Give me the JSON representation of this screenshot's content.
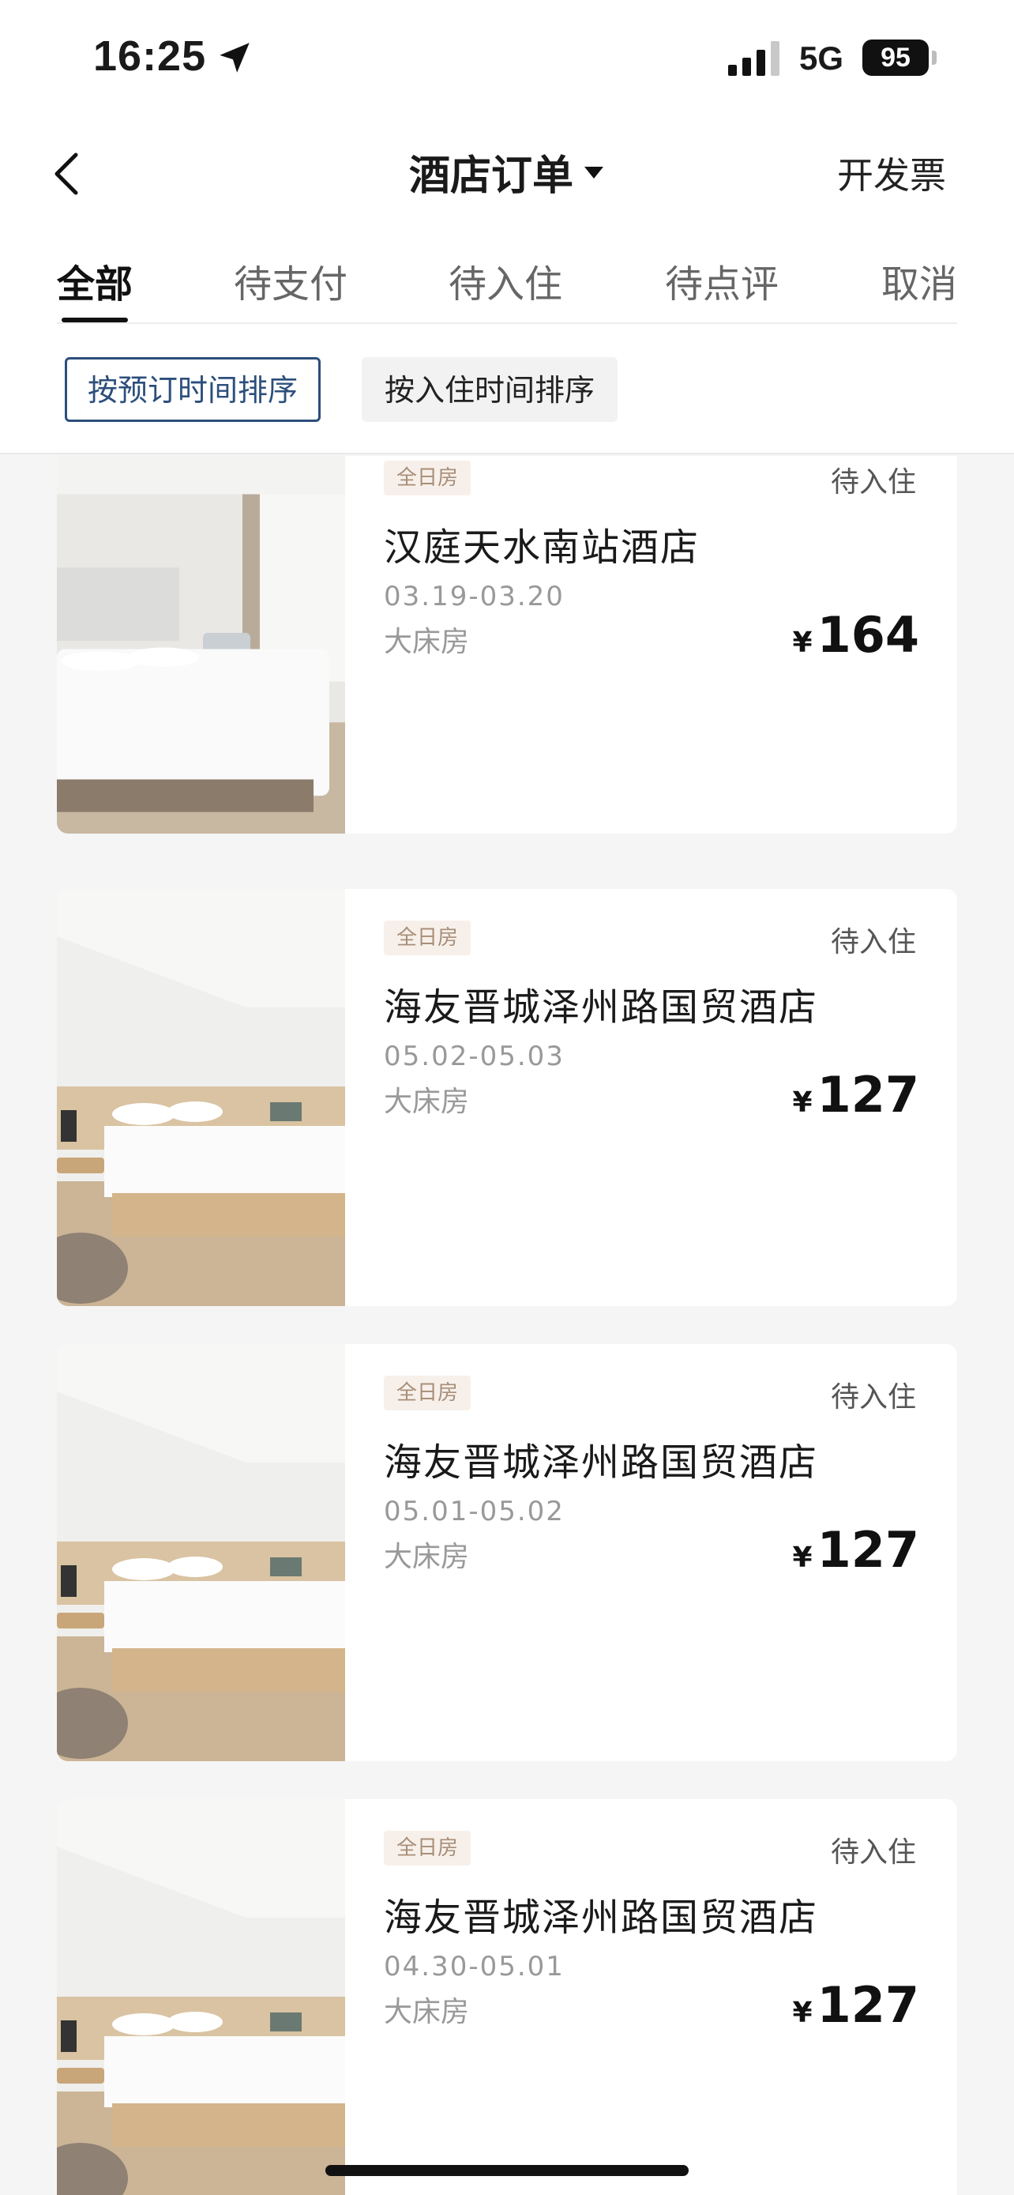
{
  "status_bar": {
    "time": "16:25",
    "network": "5G",
    "battery": "95",
    "icons": [
      "location-arrow-icon",
      "signal-icon",
      "battery-icon"
    ]
  },
  "header": {
    "title": "酒店订单",
    "invoice_label": "开发票",
    "icons": [
      "back-icon",
      "caret-down-icon"
    ]
  },
  "tabs": [
    {
      "label": "全部",
      "active": true
    },
    {
      "label": "待支付",
      "active": false
    },
    {
      "label": "待入住",
      "active": false
    },
    {
      "label": "待点评",
      "active": false
    },
    {
      "label": "取消",
      "active": false
    }
  ],
  "sort": {
    "by_booking": "按预订时间排序",
    "by_checkin": "按入住时间排序",
    "accent": "#2c4f7c"
  },
  "orders": [
    {
      "tag": "全日房",
      "status": "待入住",
      "hotel": "汉庭天水南站酒店",
      "dates": "03.19-03.20",
      "room": "大床房",
      "currency": "¥",
      "price": "164"
    },
    {
      "tag": "全日房",
      "status": "待入住",
      "hotel": "海友晋城泽州路国贸酒店",
      "dates": "05.02-05.03",
      "room": "大床房",
      "currency": "¥",
      "price": "127"
    },
    {
      "tag": "全日房",
      "status": "待入住",
      "hotel": "海友晋城泽州路国贸酒店",
      "dates": "05.01-05.02",
      "room": "大床房",
      "currency": "¥",
      "price": "127"
    },
    {
      "tag": "全日房",
      "status": "待入住",
      "hotel": "海友晋城泽州路国贸酒店",
      "dates": "04.30-05.01",
      "room": "大床房",
      "currency": "¥",
      "price": "127"
    }
  ]
}
